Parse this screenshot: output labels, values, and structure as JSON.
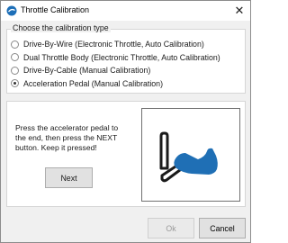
{
  "window": {
    "title": "Throttle Calibration",
    "close_glyph": "✕"
  },
  "calibration_type": {
    "legend": "Choose the calibration type",
    "options": [
      {
        "label": "Drive-By-Wire (Electronic Throttle, Auto Calibration)",
        "checked": false
      },
      {
        "label": "Dual Throttle Body (Electronic Throttle, Auto Calibration)",
        "checked": false
      },
      {
        "label": "Drive-By-Cable (Manual Calibration)",
        "checked": false
      },
      {
        "label": "Acceleration Pedal (Manual Calibration)",
        "checked": true
      }
    ]
  },
  "step": {
    "instruction": "Press the accelerator pedal to the end, then press the NEXT button. Keep it pressed!",
    "next_label": "Next",
    "illustration_icon": "pedal-pressed-icon"
  },
  "footer": {
    "ok_label": "Ok",
    "cancel_label": "Cancel"
  },
  "colors": {
    "accent": "#1d6fb8",
    "foot": "#1f6fb5"
  }
}
